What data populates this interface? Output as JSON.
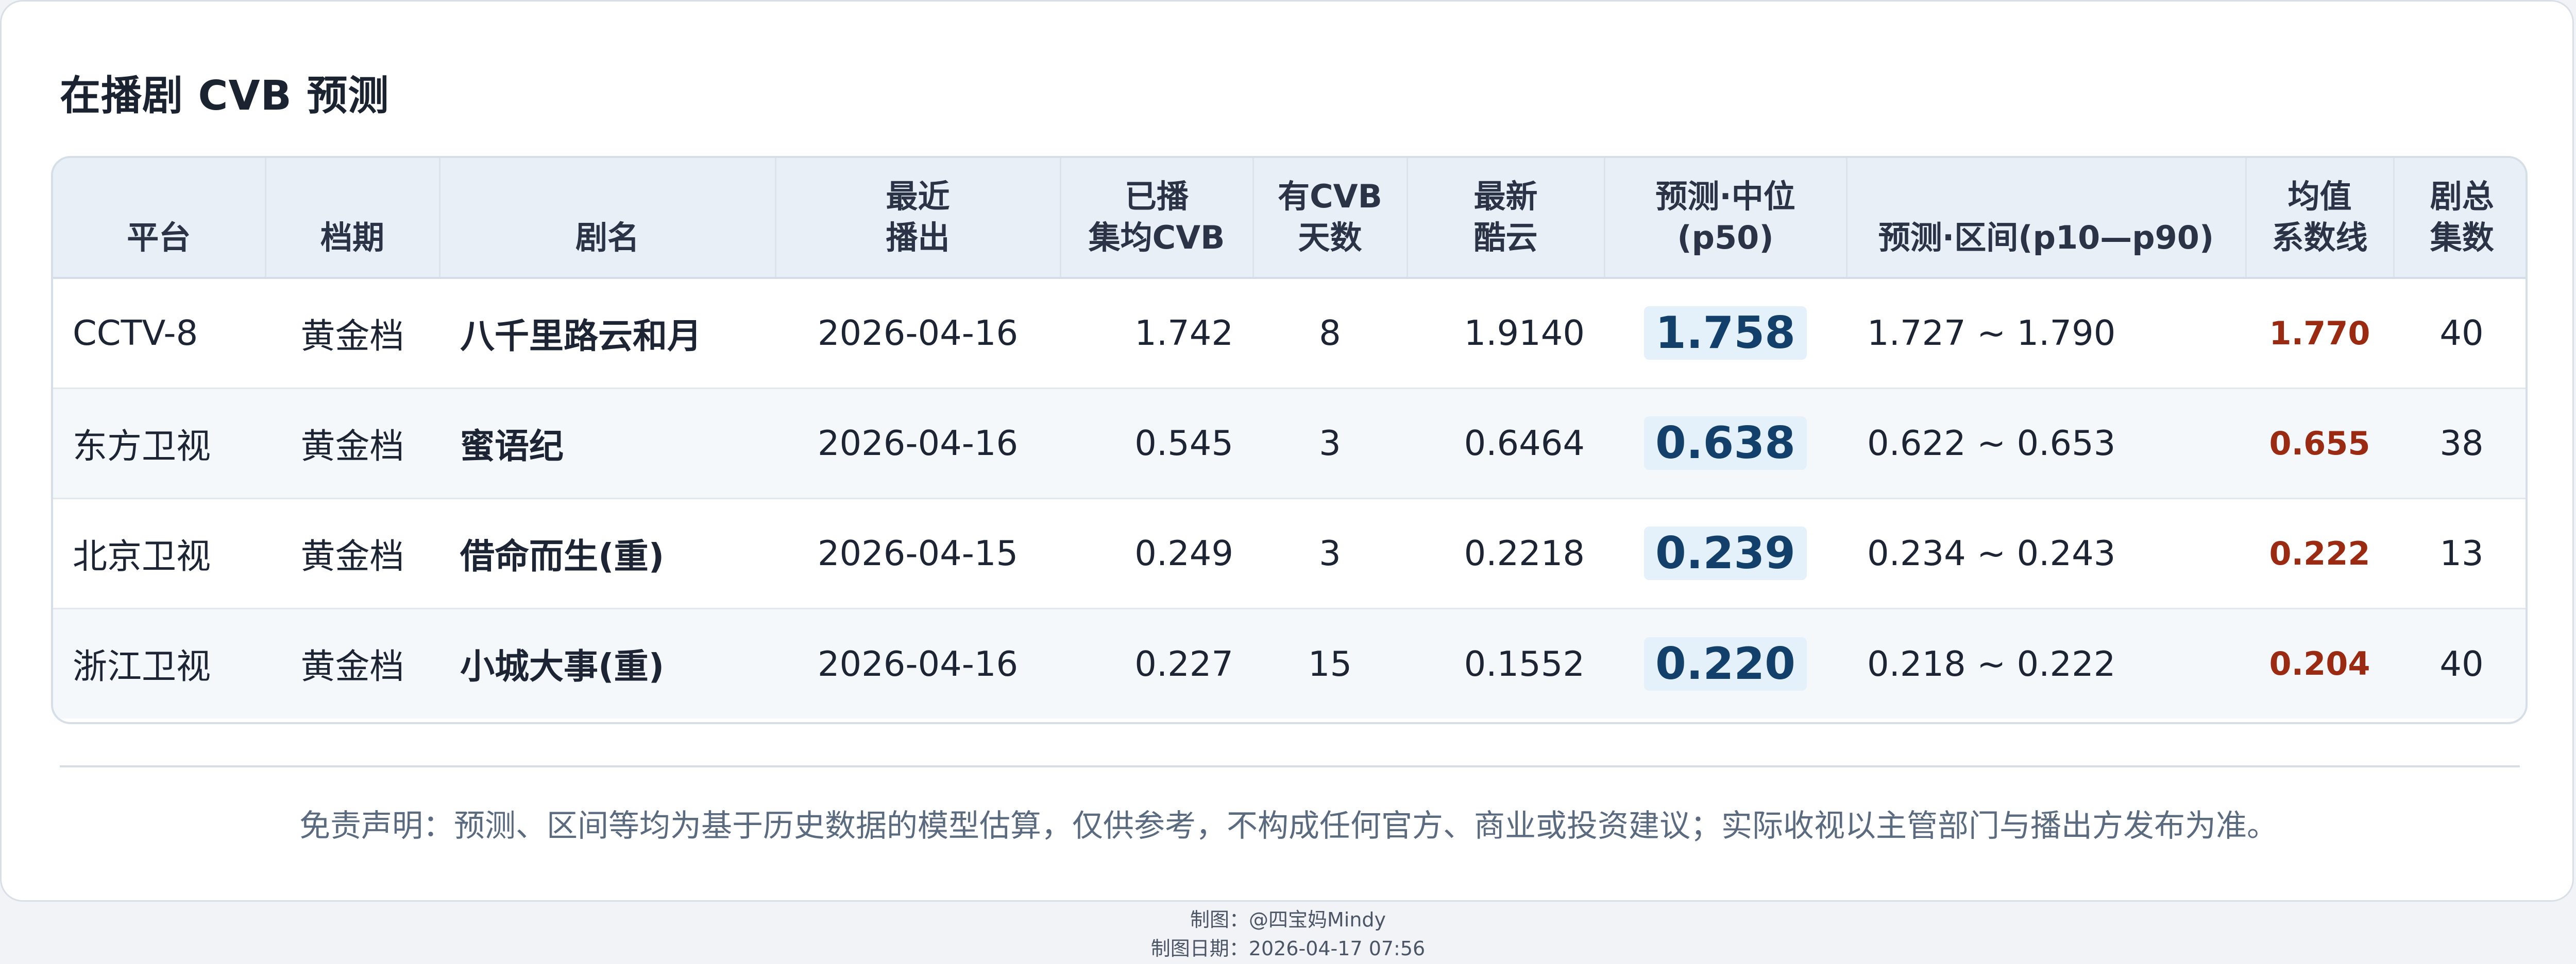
{
  "title": "在播剧 CVB 预测",
  "columns": [
    [
      "平台"
    ],
    [
      "档期"
    ],
    [
      "剧名"
    ],
    [
      "最近",
      "播出"
    ],
    [
      "已播",
      "集均CVB"
    ],
    [
      "有CVB",
      "天数"
    ],
    [
      "最新",
      "酷云"
    ],
    [
      "预测·中位",
      "(p50)"
    ],
    [
      "预测·区间(p10—p90)"
    ],
    [
      "均值",
      "系数线"
    ],
    [
      "剧总",
      "集数"
    ]
  ],
  "rows": [
    {
      "platform": "CCTV-8",
      "slot": "黄金档",
      "name": "八千里路云和月",
      "date": "2026-04-16",
      "avg_cvb": "1.742",
      "cvb_days": "8",
      "kuyun": "1.9140",
      "p50": "1.758",
      "range": "1.727 ~ 1.790",
      "mean_line": "1.770",
      "episodes": "40"
    },
    {
      "platform": "东方卫视",
      "slot": "黄金档",
      "name": "蜜语纪",
      "date": "2026-04-16",
      "avg_cvb": "0.545",
      "cvb_days": "3",
      "kuyun": "0.6464",
      "p50": "0.638",
      "range": "0.622 ~ 0.653",
      "mean_line": "0.655",
      "episodes": "38"
    },
    {
      "platform": "北京卫视",
      "slot": "黄金档",
      "name": "借命而生(重)",
      "date": "2026-04-15",
      "avg_cvb": "0.249",
      "cvb_days": "3",
      "kuyun": "0.2218",
      "p50": "0.239",
      "range": "0.234 ~ 0.243",
      "mean_line": "0.222",
      "episodes": "13"
    },
    {
      "platform": "浙江卫视",
      "slot": "黄金档",
      "name": "小城大事(重)",
      "date": "2026-04-16",
      "avg_cvb": "0.227",
      "cvb_days": "15",
      "kuyun": "0.1552",
      "p50": "0.220",
      "range": "0.218 ~ 0.222",
      "mean_line": "0.204",
      "episodes": "40"
    }
  ],
  "disclaimer": "免责声明：预测、区间等均为基于历史数据的模型估算，仅供参考，不构成任何官方、商业或投资建议；实际收视以主管部门与播出方发布为准。",
  "credit": "制图：@四宝妈Mindy",
  "credit_date": "制图日期：2026-04-17 07:56",
  "colors": {
    "p50_text": "#13406b",
    "p50_bg": "#e4f0fa",
    "mean_line_text": "#9a2b12",
    "header_bg": "#e9eff6"
  }
}
